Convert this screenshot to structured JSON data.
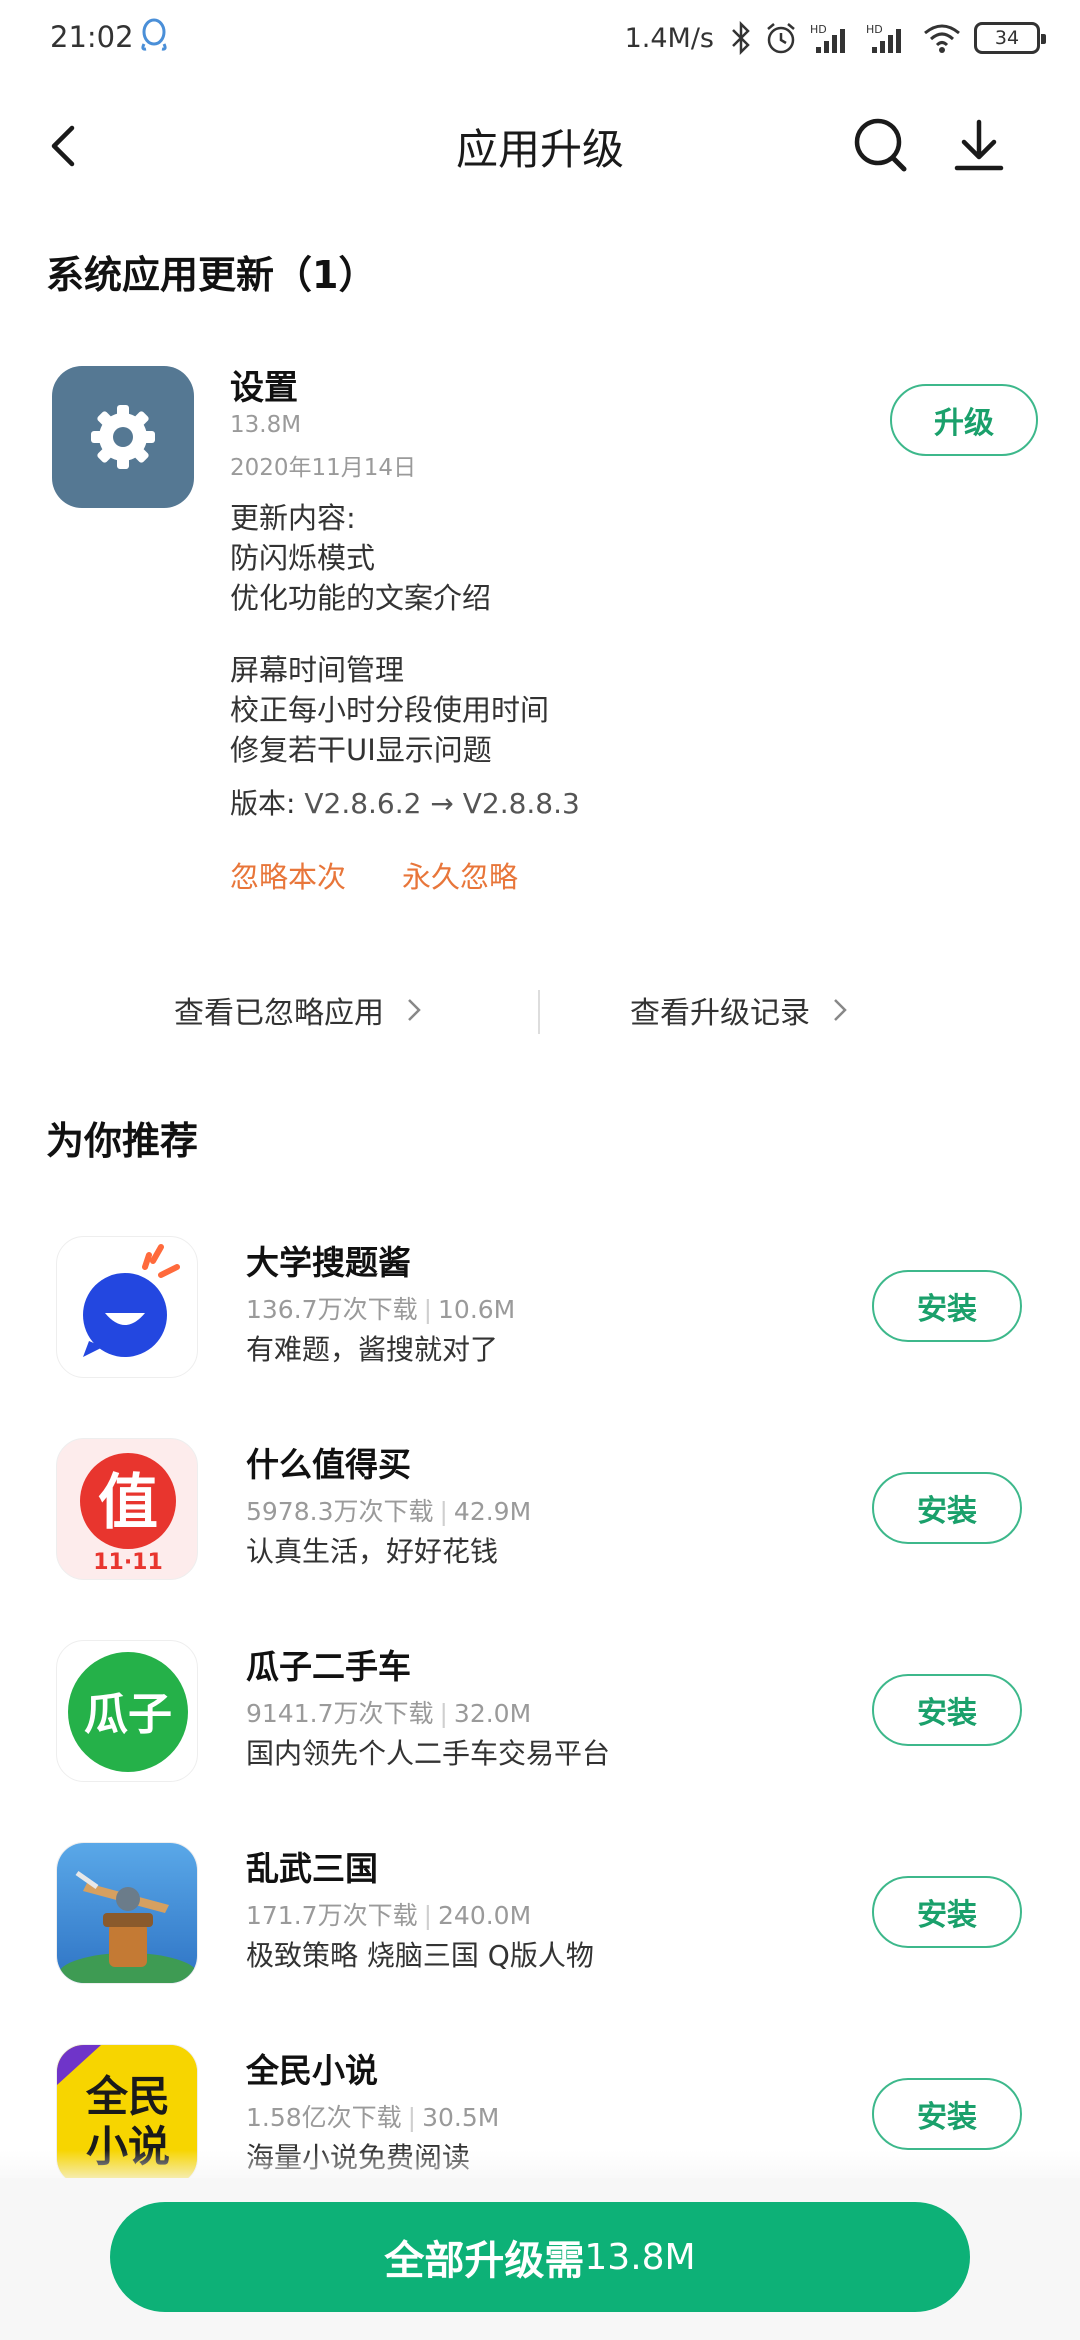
{
  "status_bar": {
    "time": "21:02",
    "net_speed": "1.4M/s",
    "battery": "34"
  },
  "nav": {
    "title": "应用升级"
  },
  "system_updates": {
    "header": "系统应用更新（1）",
    "app": {
      "name": "设置",
      "size": "13.8M",
      "date": "2020年11月14日",
      "upgrade_label": "升级",
      "changelog_title": "更新内容:",
      "changelog_group1": [
        "防闪烁模式",
        "优化功能的文案介绍"
      ],
      "changelog_group2": [
        "屏幕时间管理",
        "校正每小时分段使用时间",
        "修复若干UI显示问题"
      ],
      "version_label": "版本:",
      "version": "V2.8.6.2 → V2.8.8.3",
      "ignore_once": "忽略本次",
      "ignore_forever": "永久忽略"
    }
  },
  "links": {
    "ignored_apps": "查看已忽略应用",
    "upgrade_history": "查看升级记录"
  },
  "recommended": {
    "header": "为你推荐",
    "install_label": "安装",
    "items": [
      {
        "name": "大学搜题酱",
        "downloads": "136.7万次下载",
        "size": "10.6M",
        "desc": "有难题，酱搜就对了",
        "icon": "chat-bubble-icon"
      },
      {
        "name": "什么值得买",
        "downloads": "5978.3万次下载",
        "size": "42.9M",
        "desc": "认真生活，好好花钱",
        "icon_text": "值",
        "icon_subtext": "11·11"
      },
      {
        "name": "瓜子二手车",
        "downloads": "9141.7万次下载",
        "size": "32.0M",
        "desc": "国内领先个人二手车交易平台",
        "icon_text": "瓜子"
      },
      {
        "name": "乱武三国",
        "downloads": "171.7万次下载",
        "size": "240.0M",
        "desc": "极致策略 烧脑三国 Q版人物",
        "icon": "game-tower-icon"
      },
      {
        "name": "全民小说",
        "downloads": "1.58亿次下载",
        "size": "30.5M",
        "desc": "海量小说免费阅读",
        "icon_text": "全民",
        "icon_text2": "小说"
      }
    ]
  },
  "bottom": {
    "upgrade_all_label": "全部升级需",
    "upgrade_all_size": "13.8M"
  },
  "colors": {
    "accent_green": "#0db177",
    "outline_green": "#3db88b",
    "ignore_orange": "#e8763a",
    "settings_icon_bg": "#557893"
  }
}
